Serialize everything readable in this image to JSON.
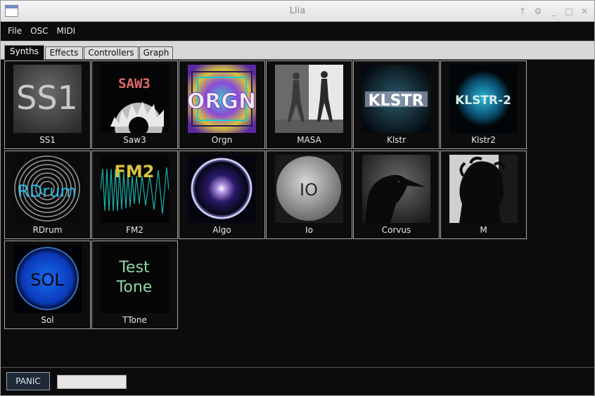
{
  "window": {
    "title": "Llia",
    "controls": [
      "↑",
      "⚙",
      "_",
      "□",
      "✕"
    ]
  },
  "menubar": {
    "items": [
      "File",
      "OSC",
      "MIDI"
    ]
  },
  "tabs": [
    {
      "label": "Synths",
      "active": true
    },
    {
      "label": "Effects",
      "active": false
    },
    {
      "label": "Controllers",
      "active": false
    },
    {
      "label": "Graph",
      "active": false
    }
  ],
  "synths": [
    {
      "name": "SS1",
      "art": "SS1"
    },
    {
      "name": "Saw3",
      "art": "SAW3"
    },
    {
      "name": "Orgn",
      "art": "ORGN"
    },
    {
      "name": "MASA",
      "art": ""
    },
    {
      "name": "Klstr",
      "art": "KLSTR"
    },
    {
      "name": "Klstr2",
      "art": "KLSTR-2"
    },
    {
      "name": "RDrum",
      "art": "RDrum"
    },
    {
      "name": "FM2",
      "art": "FM2"
    },
    {
      "name": "Algo",
      "art": ""
    },
    {
      "name": "Io",
      "art": "IO"
    },
    {
      "name": "Corvus",
      "art": ""
    },
    {
      "name": "M",
      "art": ""
    },
    {
      "name": "Sol",
      "art": "SOL"
    },
    {
      "name": "TTone",
      "art_line1": "Test",
      "art_line2": "Tone"
    }
  ],
  "bottombar": {
    "panic_label": "PANIC",
    "status_value": ""
  }
}
